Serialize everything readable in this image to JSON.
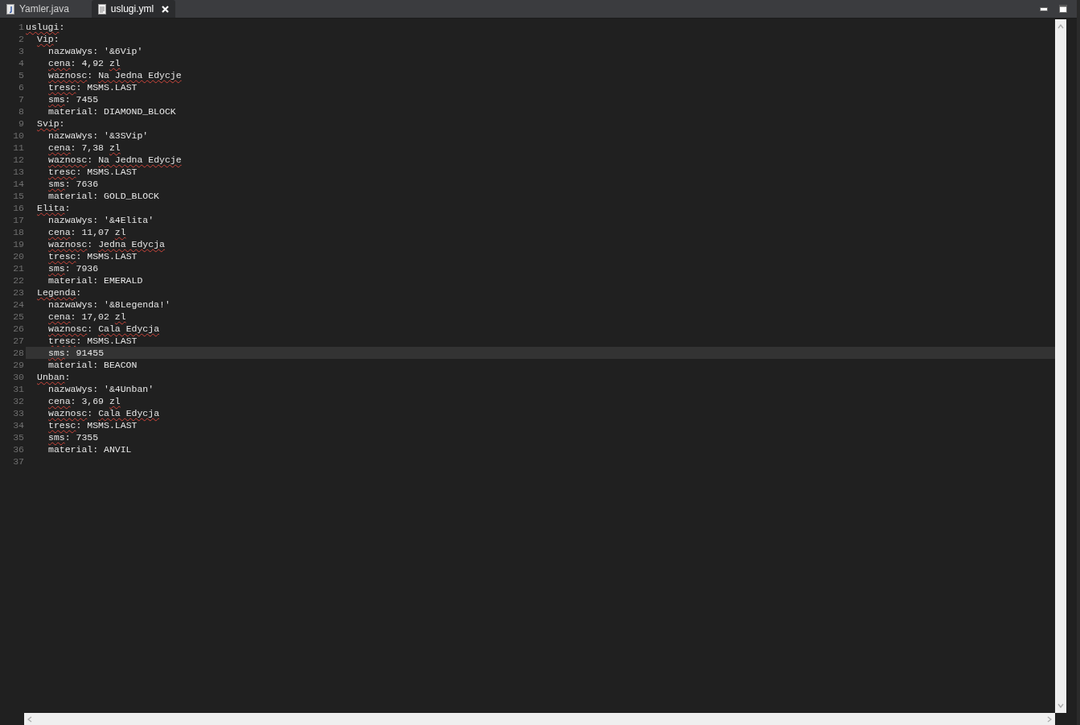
{
  "tabs": [
    {
      "label": "Yamler.java",
      "kind": "java",
      "selected": false
    },
    {
      "label": "uslugi.yml",
      "kind": "text",
      "selected": true
    }
  ],
  "window_controls": [
    {
      "kind": "minimize"
    },
    {
      "kind": "maximize"
    }
  ],
  "lines": [
    {
      "number": "1",
      "current": false,
      "segments": [
        {
          "text": "uslugi",
          "misspelled": true
        },
        {
          "text": ":",
          "misspelled": false
        }
      ],
      "children": [
        {
          "number": "2",
          "current": false,
          "segments": [
            {
              "text": "Vip",
              "misspelled": true
            },
            {
              "text": ":",
              "misspelled": false
            }
          ],
          "children": [
            {
              "number": "3",
              "current": false,
              "segments": [
                {
                  "text": "nazwaWys: '&6Vip'",
                  "misspelled": false
                }
              ]
            },
            {
              "number": "4",
              "current": false,
              "segments": [
                {
                  "text": "cena",
                  "misspelled": true
                },
                {
                  "text": ": 4,92 ",
                  "misspelled": false
                },
                {
                  "text": "zl",
                  "misspelled": true
                }
              ]
            },
            {
              "number": "5",
              "current": false,
              "segments": [
                {
                  "text": "waznosc",
                  "misspelled": true
                },
                {
                  "text": ": ",
                  "misspelled": false
                },
                {
                  "text": "Na Jedna Edycje",
                  "misspelled": true
                }
              ]
            },
            {
              "number": "6",
              "current": false,
              "segments": [
                {
                  "text": "tresc",
                  "misspelled": true
                },
                {
                  "text": ": MSMS.LAST",
                  "misspelled": false
                }
              ]
            },
            {
              "number": "7",
              "current": false,
              "segments": [
                {
                  "text": "sms",
                  "misspelled": true
                },
                {
                  "text": ": 7455",
                  "misspelled": false
                }
              ]
            },
            {
              "number": "8",
              "current": false,
              "segments": [
                {
                  "text": "material: DIAMOND_BLOCK",
                  "misspelled": false
                }
              ]
            }
          ]
        },
        {
          "number": "9",
          "current": false,
          "segments": [
            {
              "text": "Svip",
              "misspelled": true
            },
            {
              "text": ":",
              "misspelled": false
            }
          ],
          "children": [
            {
              "number": "10",
              "current": false,
              "segments": [
                {
                  "text": "nazwaWys: '&3SVip'",
                  "misspelled": false
                }
              ]
            },
            {
              "number": "11",
              "current": false,
              "segments": [
                {
                  "text": "cena",
                  "misspelled": true
                },
                {
                  "text": ": 7,38 ",
                  "misspelled": false
                },
                {
                  "text": "zl",
                  "misspelled": true
                }
              ]
            },
            {
              "number": "12",
              "current": false,
              "segments": [
                {
                  "text": "waznosc",
                  "misspelled": true
                },
                {
                  "text": ": ",
                  "misspelled": false
                },
                {
                  "text": "Na Jedna Edycje",
                  "misspelled": true
                }
              ]
            },
            {
              "number": "13",
              "current": false,
              "segments": [
                {
                  "text": "tresc",
                  "misspelled": true
                },
                {
                  "text": ": MSMS.LAST",
                  "misspelled": false
                }
              ]
            },
            {
              "number": "14",
              "current": false,
              "segments": [
                {
                  "text": "sms",
                  "misspelled": true
                },
                {
                  "text": ": 7636",
                  "misspelled": false
                }
              ]
            },
            {
              "number": "15",
              "current": false,
              "segments": [
                {
                  "text": "material: GOLD_BLOCK",
                  "misspelled": false
                }
              ]
            }
          ]
        },
        {
          "number": "16",
          "current": false,
          "segments": [
            {
              "text": "Elita",
              "misspelled": true
            },
            {
              "text": ":",
              "misspelled": false
            }
          ],
          "children": [
            {
              "number": "17",
              "current": false,
              "segments": [
                {
                  "text": "nazwaWys: '&4Elita'",
                  "misspelled": false
                }
              ]
            },
            {
              "number": "18",
              "current": false,
              "segments": [
                {
                  "text": "cena",
                  "misspelled": true
                },
                {
                  "text": ": 11,07 ",
                  "misspelled": false
                },
                {
                  "text": "zl",
                  "misspelled": true
                }
              ]
            },
            {
              "number": "19",
              "current": false,
              "segments": [
                {
                  "text": "waznosc",
                  "misspelled": true
                },
                {
                  "text": ": ",
                  "misspelled": false
                },
                {
                  "text": "Jedna Edycja",
                  "misspelled": true
                }
              ]
            },
            {
              "number": "20",
              "current": false,
              "segments": [
                {
                  "text": "tresc",
                  "misspelled": true
                },
                {
                  "text": ": MSMS.LAST",
                  "misspelled": false
                }
              ]
            },
            {
              "number": "21",
              "current": false,
              "segments": [
                {
                  "text": "sms",
                  "misspelled": true
                },
                {
                  "text": ": 7936",
                  "misspelled": false
                }
              ]
            },
            {
              "number": "22",
              "current": false,
              "segments": [
                {
                  "text": "material: EMERALD",
                  "misspelled": false
                }
              ]
            }
          ]
        },
        {
          "number": "23",
          "current": false,
          "segments": [
            {
              "text": "Legenda",
              "misspelled": true
            },
            {
              "text": ":",
              "misspelled": false
            }
          ],
          "children": [
            {
              "number": "24",
              "current": false,
              "segments": [
                {
                  "text": "nazwaWys: '&8Legenda!'",
                  "misspelled": false
                }
              ]
            },
            {
              "number": "25",
              "current": false,
              "segments": [
                {
                  "text": "cena",
                  "misspelled": true
                },
                {
                  "text": ": 17,02 ",
                  "misspelled": false
                },
                {
                  "text": "zl",
                  "misspelled": true
                }
              ]
            },
            {
              "number": "26",
              "current": false,
              "segments": [
                {
                  "text": "waznosc",
                  "misspelled": true
                },
                {
                  "text": ": ",
                  "misspelled": false
                },
                {
                  "text": "Cala Edycja",
                  "misspelled": true
                }
              ]
            },
            {
              "number": "27",
              "current": false,
              "segments": [
                {
                  "text": "tresc",
                  "misspelled": true
                },
                {
                  "text": ": MSMS.LAST",
                  "misspelled": false
                }
              ]
            },
            {
              "number": "28",
              "current": true,
              "segments": [
                {
                  "text": "sms",
                  "misspelled": true
                },
                {
                  "text": ": 91455",
                  "misspelled": false
                }
              ]
            },
            {
              "number": "29",
              "current": false,
              "segments": [
                {
                  "text": "material: BEACON",
                  "misspelled": false
                }
              ]
            }
          ]
        },
        {
          "number": "30",
          "current": false,
          "segments": [
            {
              "text": "Unban",
              "misspelled": true
            },
            {
              "text": ":",
              "misspelled": false
            }
          ],
          "children": [
            {
              "number": "31",
              "current": false,
              "segments": [
                {
                  "text": "nazwaWys: '&4Unban'",
                  "misspelled": false
                }
              ]
            },
            {
              "number": "32",
              "current": false,
              "segments": [
                {
                  "text": "cena",
                  "misspelled": true
                },
                {
                  "text": ": 3,69 ",
                  "misspelled": false
                },
                {
                  "text": "zl",
                  "misspelled": true
                }
              ]
            },
            {
              "number": "33",
              "current": false,
              "segments": [
                {
                  "text": "waznosc",
                  "misspelled": true
                },
                {
                  "text": ": ",
                  "misspelled": false
                },
                {
                  "text": "Cala Edycja",
                  "misspelled": true
                }
              ]
            },
            {
              "number": "34",
              "current": false,
              "segments": [
                {
                  "text": "tresc",
                  "misspelled": true
                },
                {
                  "text": ": MSMS.LAST",
                  "misspelled": false
                }
              ]
            },
            {
              "number": "35",
              "current": false,
              "segments": [
                {
                  "text": "sms",
                  "misspelled": true
                },
                {
                  "text": ": 7355",
                  "misspelled": false
                }
              ]
            },
            {
              "number": "36",
              "current": false,
              "segments": [
                {
                  "text": "material: ANVIL",
                  "misspelled": false
                }
              ]
            }
          ]
        }
      ]
    },
    {
      "number": "37",
      "current": false
    }
  ]
}
